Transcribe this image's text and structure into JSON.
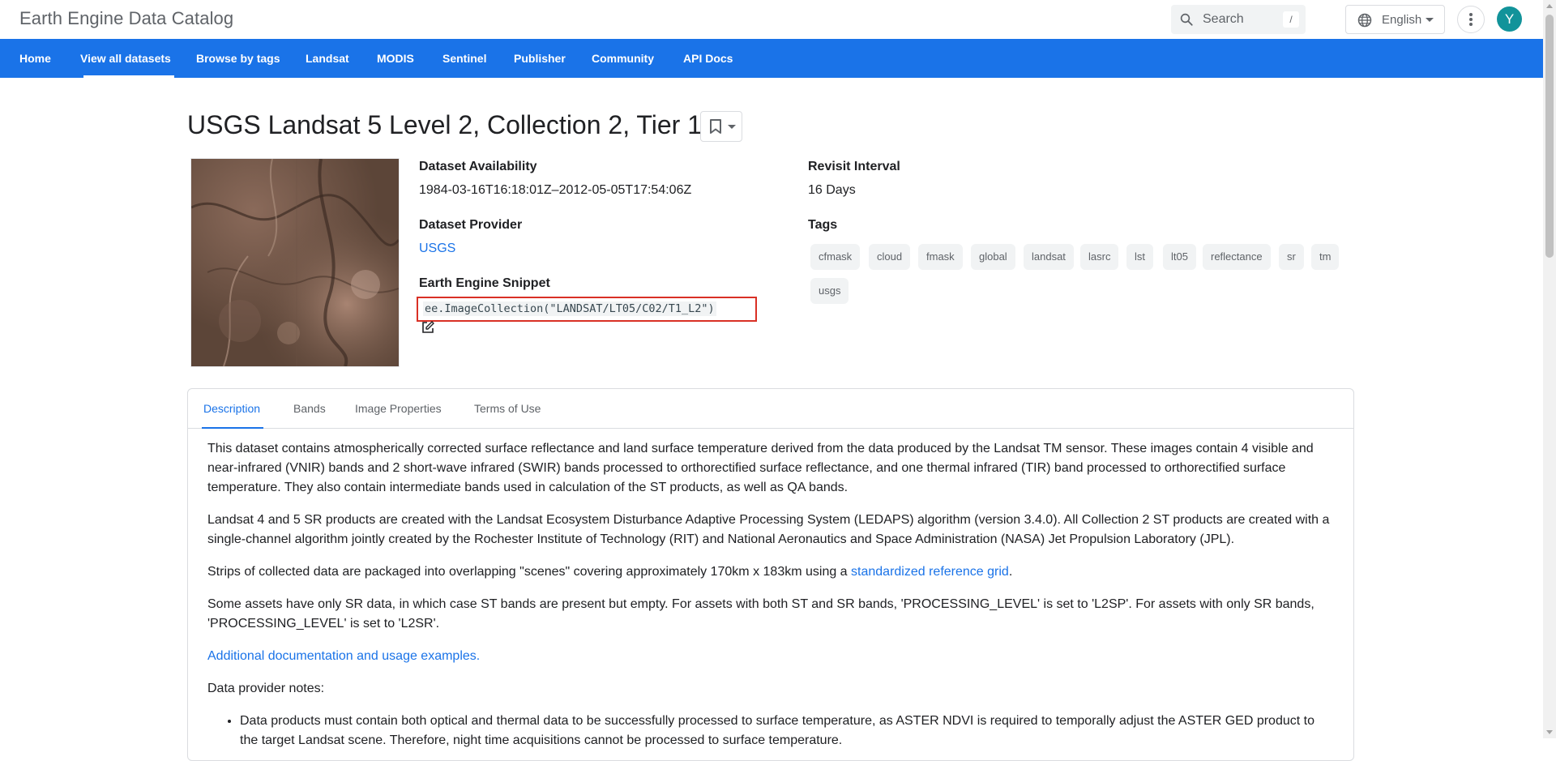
{
  "header": {
    "app_title": "Earth Engine Data Catalog",
    "search_placeholder": "Search",
    "search_shortcut": "/",
    "language": "English",
    "avatar_letter": "Y",
    "avatar_color": "#12939a"
  },
  "nav": {
    "items": [
      "Home",
      "View all datasets",
      "Browse by tags",
      "Landsat",
      "MODIS",
      "Sentinel",
      "Publisher",
      "Community",
      "API Docs"
    ],
    "active": "View all datasets",
    "bar_color": "#1a73e8"
  },
  "dataset": {
    "title": "USGS Landsat 5 Level 2, Collection 2, Tier 1",
    "availability_label": "Dataset Availability",
    "availability_value": "1984-03-16T16:18:01Z–2012-05-05T17:54:06Z",
    "provider_label": "Dataset Provider",
    "provider_value": "USGS",
    "snippet_label": "Earth Engine Snippet",
    "snippet_value": "ee.ImageCollection(\"LANDSAT/LT05/C02/T1_L2\")",
    "revisit_label": "Revisit Interval",
    "revisit_value": "16 Days",
    "tags_label": "Tags",
    "tags": [
      "cfmask",
      "cloud",
      "fmask",
      "global",
      "landsat",
      "lasrc",
      "lst",
      "lt05",
      "reflectance",
      "sr",
      "tm",
      "usgs"
    ]
  },
  "tabs": {
    "items": [
      "Description",
      "Bands",
      "Image Properties",
      "Terms of Use"
    ],
    "active": "Description"
  },
  "description": {
    "p1": "This dataset contains atmospherically corrected surface reflectance and land surface temperature derived from the data produced by the Landsat TM sensor. These images contain 4 visible and near-infrared (VNIR) bands and 2 short-wave infrared (SWIR) bands processed to orthorectified surface reflectance, and one thermal infrared (TIR) band processed to orthorectified surface temperature. They also contain intermediate bands used in calculation of the ST products, as well as QA bands.",
    "p2": "Landsat 4 and 5 SR products are created with the Landsat Ecosystem Disturbance Adaptive Processing System (LEDAPS) algorithm (version 3.4.0). All Collection 2 ST products are created with a single-channel algorithm jointly created by the Rochester Institute of Technology (RIT) and National Aeronautics and Space Administration (NASA) Jet Propulsion Laboratory (JPL).",
    "p3_before": "Strips of collected data are packaged into overlapping \"scenes\" covering approximately 170km x 183km using a ",
    "p3_link": "standardized reference grid",
    "p3_after": ".",
    "p4": "Some assets have only SR data, in which case ST bands are present but empty. For assets with both ST and SR bands, 'PROCESSING_LEVEL' is set to 'L2SP'. For assets with only SR bands, 'PROCESSING_LEVEL' is set to 'L2SR'.",
    "p5_link": "Additional documentation and usage examples.",
    "p6": "Data provider notes:",
    "bullet1": "Data products must contain both optical and thermal data to be successfully processed to surface temperature, as ASTER NDVI is required to temporally adjust the ASTER GED product to the target Landsat scene. Therefore, night time acquisitions cannot be processed to surface temperature."
  }
}
